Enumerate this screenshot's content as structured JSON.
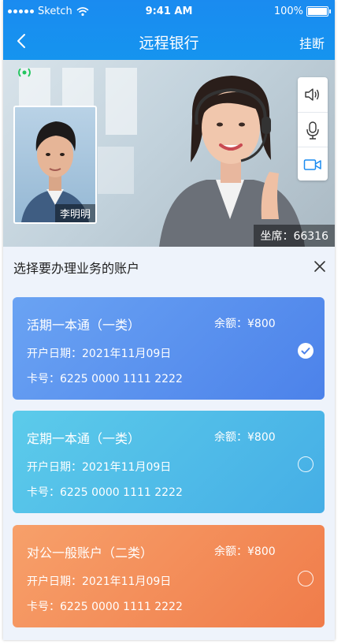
{
  "status_bar": {
    "carrier": "Sketch",
    "time": "9:41 AM",
    "battery": "100%"
  },
  "nav": {
    "title": "远程银行",
    "hangup_label": "挂断"
  },
  "video": {
    "self_name": "李明明",
    "seat_label": "坐席：66316"
  },
  "panel": {
    "title": "选择要办理业务的账户",
    "accounts": [
      {
        "name": "活期一本通（一类）",
        "balance": "余额：¥800",
        "open_date": "开户日期：2021年11月09日",
        "card_no": "卡号：6225 0000 1111 2222",
        "selected": true
      },
      {
        "name": "定期一本通（一类）",
        "balance": "余额：¥800",
        "open_date": "开户日期：2021年11月09日",
        "card_no": "卡号：6225 0000 1111 2222",
        "selected": false
      },
      {
        "name": "对公一般账户（二类）",
        "balance": "余额：¥800",
        "open_date": "开户日期：2021年11月09日",
        "card_no": "卡号：6225 0000 1111 2222",
        "selected": false
      }
    ]
  },
  "colors": {
    "header_blue": "#1a8bf0",
    "card_blue": "#4c82ea",
    "card_cyan": "#45aee6",
    "card_orange": "#f07c4a",
    "signal_green": "#22c55e"
  },
  "icons": [
    "back-arrow-icon",
    "wifi-icon",
    "signal-icon",
    "speaker-icon",
    "microphone-icon",
    "camera-icon",
    "close-icon",
    "check-icon"
  ]
}
